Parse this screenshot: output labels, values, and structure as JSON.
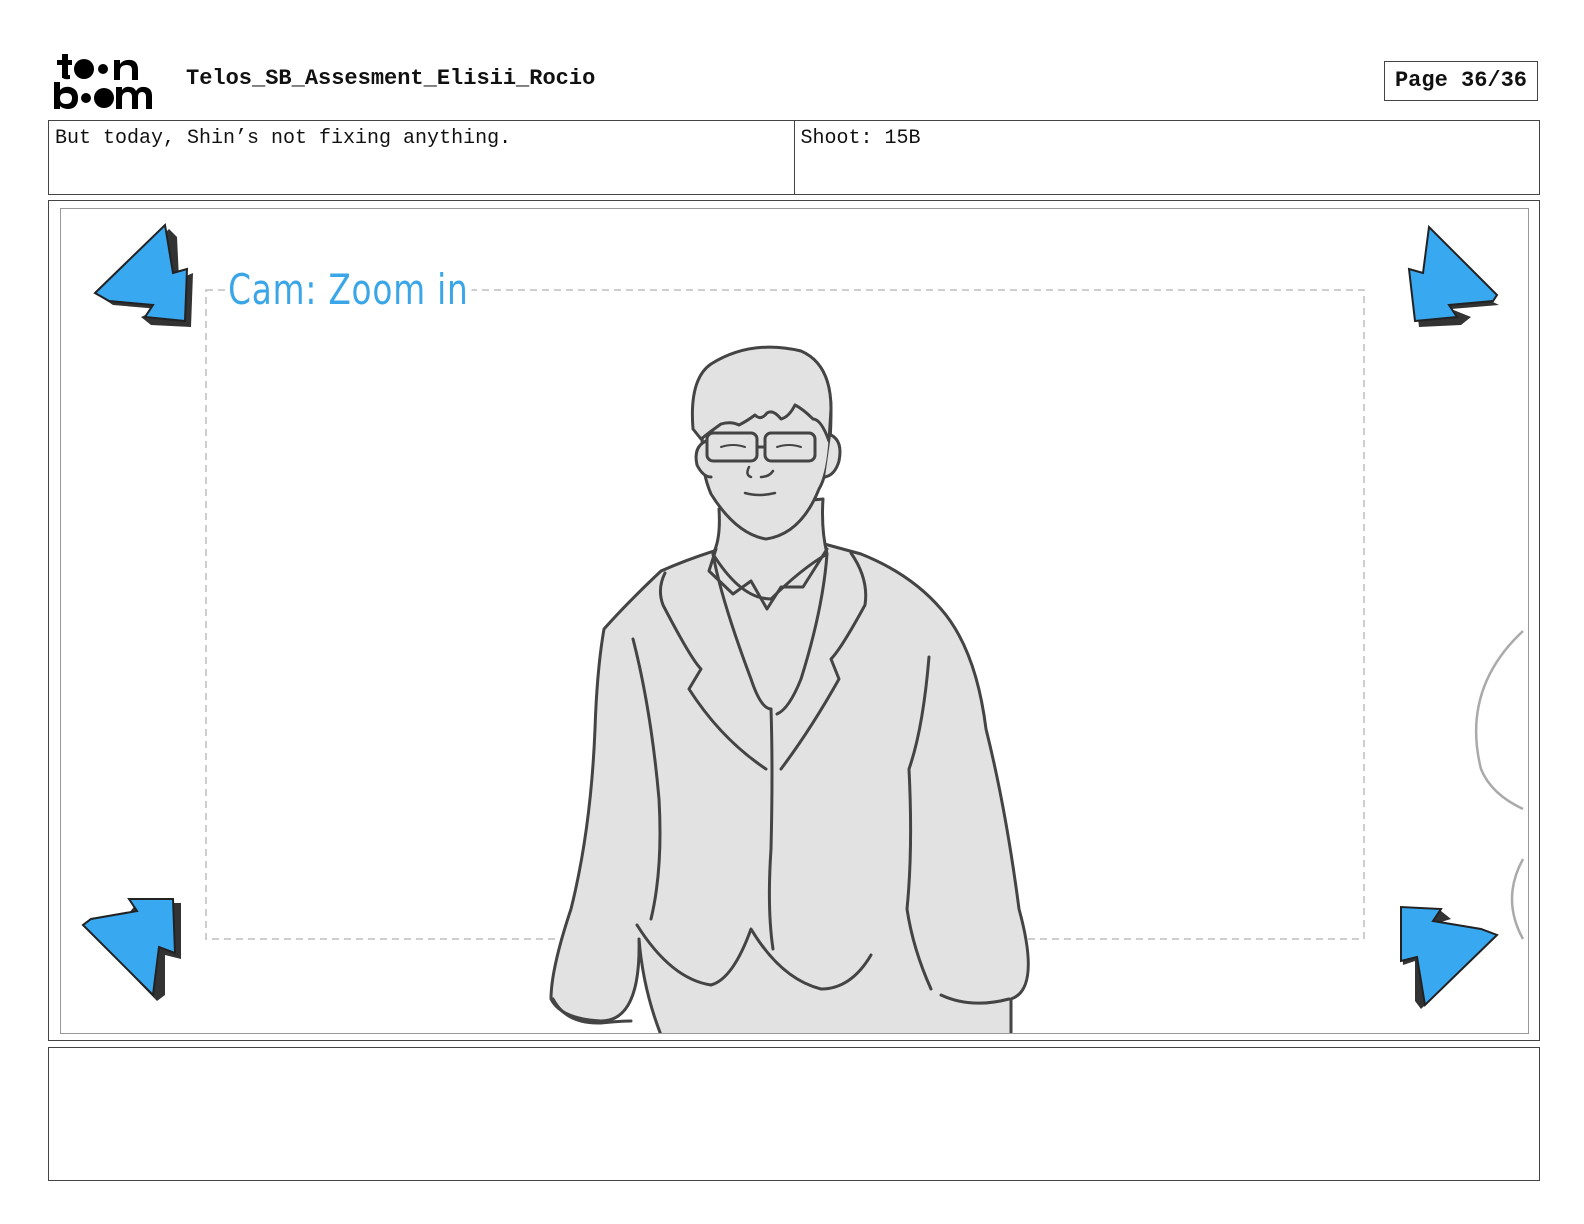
{
  "header": {
    "title": "Telos_SB_Assesment_Elisii_Rocio",
    "page_label": "Page 36/36",
    "logo_text": "toon boom"
  },
  "info": {
    "dialogue": "But today, Shin’s not fixing anything.",
    "shot": "Shoot: 15B"
  },
  "panel": {
    "camera_note": "Cam: Zoom in",
    "arrow_color": "#38a8f0"
  },
  "notes": {
    "text": ""
  }
}
